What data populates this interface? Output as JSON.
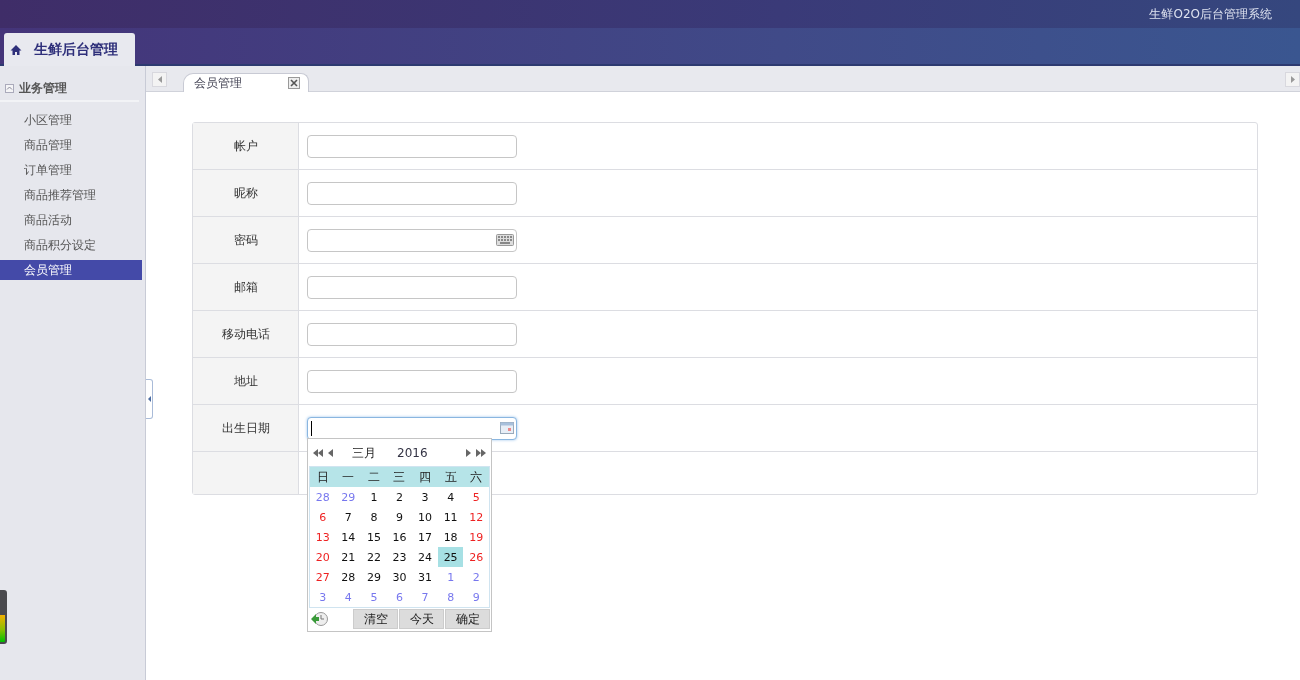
{
  "header": {
    "system_title": "生鲜O2O后台管理系统"
  },
  "app_tab": {
    "label": "生鲜后台管理",
    "selected": true
  },
  "sidebar": {
    "group": {
      "label": "业务管理",
      "expanded": true
    },
    "items": [
      {
        "label": "小区管理",
        "selected": false
      },
      {
        "label": "商品管理",
        "selected": false
      },
      {
        "label": "订单管理",
        "selected": false
      },
      {
        "label": "商品推荐管理",
        "selected": false
      },
      {
        "label": "商品活动",
        "selected": false
      },
      {
        "label": "商品积分设定",
        "selected": false
      },
      {
        "label": "会员管理",
        "selected": true
      }
    ]
  },
  "tabs": [
    {
      "label": "会员管理",
      "selected": true
    }
  ],
  "form": {
    "rows": [
      {
        "label": "帐户",
        "kind": "text",
        "focused": false
      },
      {
        "label": "昵称",
        "kind": "text",
        "focused": false
      },
      {
        "label": "密码",
        "kind": "password",
        "focused": false
      },
      {
        "label": "邮箱",
        "kind": "text",
        "focused": false
      },
      {
        "label": "移动电话",
        "kind": "text",
        "focused": false
      },
      {
        "label": "地址",
        "kind": "text",
        "focused": false
      },
      {
        "label": "出生日期",
        "kind": "date",
        "focused": true
      },
      {
        "kind": "empty"
      }
    ]
  },
  "calendar": {
    "month": "三月",
    "year": "2016",
    "weekdays": [
      "日",
      "一",
      "二",
      "三",
      "四",
      "五",
      "六"
    ],
    "days": [
      {
        "text": "28",
        "kind": "other",
        "selected": false
      },
      {
        "text": "29",
        "kind": "other",
        "selected": false
      },
      {
        "text": "1",
        "kind": "weekday",
        "selected": false
      },
      {
        "text": "2",
        "kind": "weekday",
        "selected": false
      },
      {
        "text": "3",
        "kind": "weekday",
        "selected": false
      },
      {
        "text": "4",
        "kind": "weekday",
        "selected": false
      },
      {
        "text": "5",
        "kind": "weekend",
        "selected": false
      },
      {
        "text": "6",
        "kind": "weekend",
        "selected": false
      },
      {
        "text": "7",
        "kind": "weekday",
        "selected": false
      },
      {
        "text": "8",
        "kind": "weekday",
        "selected": false
      },
      {
        "text": "9",
        "kind": "weekday",
        "selected": false
      },
      {
        "text": "10",
        "kind": "weekday",
        "selected": false
      },
      {
        "text": "11",
        "kind": "weekday",
        "selected": false
      },
      {
        "text": "12",
        "kind": "weekend",
        "selected": false
      },
      {
        "text": "13",
        "kind": "weekend",
        "selected": false
      },
      {
        "text": "14",
        "kind": "weekday",
        "selected": false
      },
      {
        "text": "15",
        "kind": "weekday",
        "selected": false
      },
      {
        "text": "16",
        "kind": "weekday",
        "selected": false
      },
      {
        "text": "17",
        "kind": "weekday",
        "selected": false
      },
      {
        "text": "18",
        "kind": "weekday",
        "selected": false
      },
      {
        "text": "19",
        "kind": "weekend",
        "selected": false
      },
      {
        "text": "20",
        "kind": "weekend",
        "selected": false
      },
      {
        "text": "21",
        "kind": "weekday",
        "selected": false
      },
      {
        "text": "22",
        "kind": "weekday",
        "selected": false
      },
      {
        "text": "23",
        "kind": "weekday",
        "selected": false
      },
      {
        "text": "24",
        "kind": "weekday",
        "selected": false
      },
      {
        "text": "25",
        "kind": "weekday",
        "selected": true
      },
      {
        "text": "26",
        "kind": "weekend",
        "selected": false
      },
      {
        "text": "27",
        "kind": "weekend",
        "selected": false
      },
      {
        "text": "28",
        "kind": "weekday",
        "selected": false
      },
      {
        "text": "29",
        "kind": "weekday",
        "selected": false
      },
      {
        "text": "30",
        "kind": "weekday",
        "selected": false
      },
      {
        "text": "31",
        "kind": "weekday",
        "selected": false
      },
      {
        "text": "1",
        "kind": "other",
        "selected": false
      },
      {
        "text": "2",
        "kind": "other",
        "selected": false
      },
      {
        "text": "3",
        "kind": "other",
        "selected": false
      },
      {
        "text": "4",
        "kind": "other",
        "selected": false
      },
      {
        "text": "5",
        "kind": "other",
        "selected": false
      },
      {
        "text": "6",
        "kind": "other",
        "selected": false
      },
      {
        "text": "7",
        "kind": "other",
        "selected": false
      },
      {
        "text": "8",
        "kind": "other",
        "selected": false
      },
      {
        "text": "9",
        "kind": "other",
        "selected": false
      }
    ],
    "buttons": [
      "清空",
      "今天",
      "确定"
    ]
  }
}
